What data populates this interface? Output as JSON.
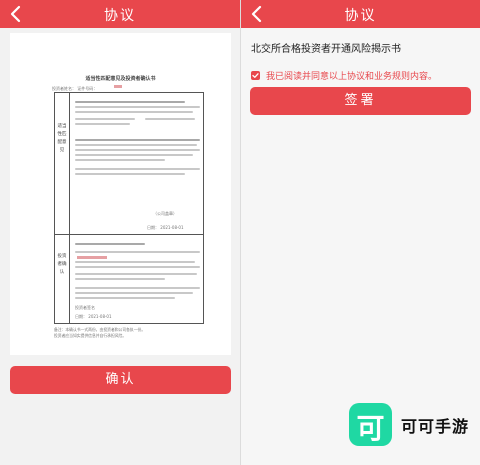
{
  "left_screen": {
    "title": "协议",
    "document": {
      "heading": "适当性匹配意见及投资者确认书",
      "meta": "投资者姓名：    证件号码：",
      "section_1_label": "适当性匹配意见",
      "section_2_label": "投资者确认",
      "stamp_1": "（公司盖章）",
      "date_1": "日期：  2021-08-01",
      "signature_label": "投资者签名",
      "date_2": "日期：  2021-08-01",
      "footnote_1": "备注：本确认书一式两份，由投资者和公司各执一份。",
      "footnote_2": "投资者应当如实提供信息并自行承担风险。"
    },
    "confirm_button": "确认"
  },
  "right_screen": {
    "title": "协议",
    "notice_title": "北交所合格投资者开通风险揭示书",
    "agree_text": "我已阅读并同意以上协议和业务规则内容。",
    "agree_checked": true,
    "sign_button": "签署"
  },
  "watermark": {
    "logo_glyph": "可",
    "brand_name": "可可手游"
  },
  "colors": {
    "accent": "#e8474c",
    "watermark_green": "#1fd8a3"
  }
}
